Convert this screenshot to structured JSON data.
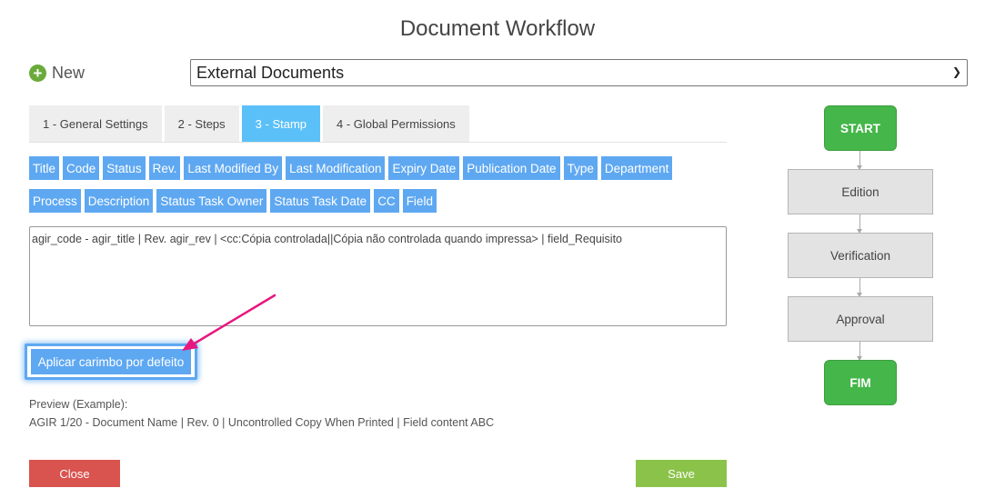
{
  "title": "Document Workflow",
  "new_button": {
    "label": "New",
    "icon": "plus-circle-icon"
  },
  "workflow_select": {
    "value": "External Documents"
  },
  "tabs": [
    {
      "label": "1 - General Settings",
      "active": false
    },
    {
      "label": "2 - Steps",
      "active": false
    },
    {
      "label": "3 - Stamp",
      "active": true
    },
    {
      "label": "4 - Global Permissions",
      "active": false
    }
  ],
  "tags_row1": [
    "Title",
    "Code",
    "Status",
    "Rev.",
    "Last Modified By",
    "Last Modification",
    "Expiry Date",
    "Publication Date",
    "Type",
    "Department"
  ],
  "tags_row2": [
    "Process",
    "Description",
    "Status Task Owner",
    "Status Task Date",
    "CC",
    "Field"
  ],
  "stamp_text": "agir_code - agir_title | Rev. agir_rev | <cc:Cópia controlada||Cópia não controlada quando impressa> | field_Requisito",
  "default_button": {
    "label": "Aplicar carimbo por defeito"
  },
  "preview": {
    "label": "Preview (Example):",
    "text": "AGIR 1/20 - Document Name | Rev. 0 | Uncontrolled Copy When Printed | Field content ABC"
  },
  "close_label": "Close",
  "save_label": "Save",
  "flow": {
    "start": "START",
    "steps": [
      "Edition",
      "Verification",
      "Approval"
    ],
    "end": "FIM"
  },
  "colors": {
    "tab_active": "#5bc0f8",
    "tag": "#5ea8f2",
    "close": "#d9534f",
    "save": "#8bc34a",
    "flow_terminal": "#45b649",
    "annotation_arrow": "#e8177d"
  }
}
